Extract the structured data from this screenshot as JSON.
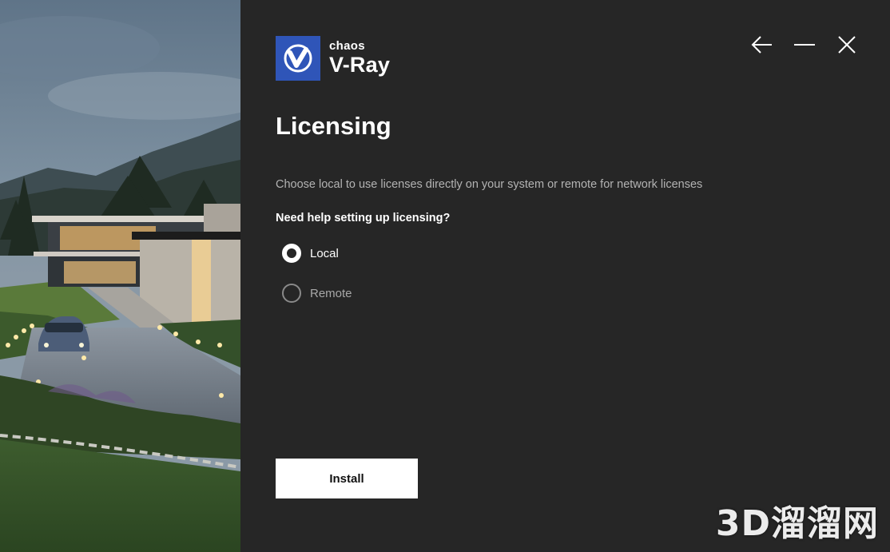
{
  "brand": {
    "company": "chaos",
    "product": "V-Ray"
  },
  "page": {
    "title": "Licensing",
    "description": "Choose local to use licenses directly on your system or remote for network licenses",
    "help_link": "Need help setting up licensing?"
  },
  "license_options": [
    {
      "label": "Local",
      "selected": true
    },
    {
      "label": "Remote",
      "selected": false
    }
  ],
  "actions": {
    "install_label": "Install"
  },
  "window_controls": [
    "back-arrow-icon",
    "minimize-icon",
    "close-icon"
  ],
  "watermark": "3D溜溜网",
  "colors": {
    "background": "#262626",
    "logo_blue": "#2f55b8",
    "muted_text": "#b3b3b3"
  }
}
